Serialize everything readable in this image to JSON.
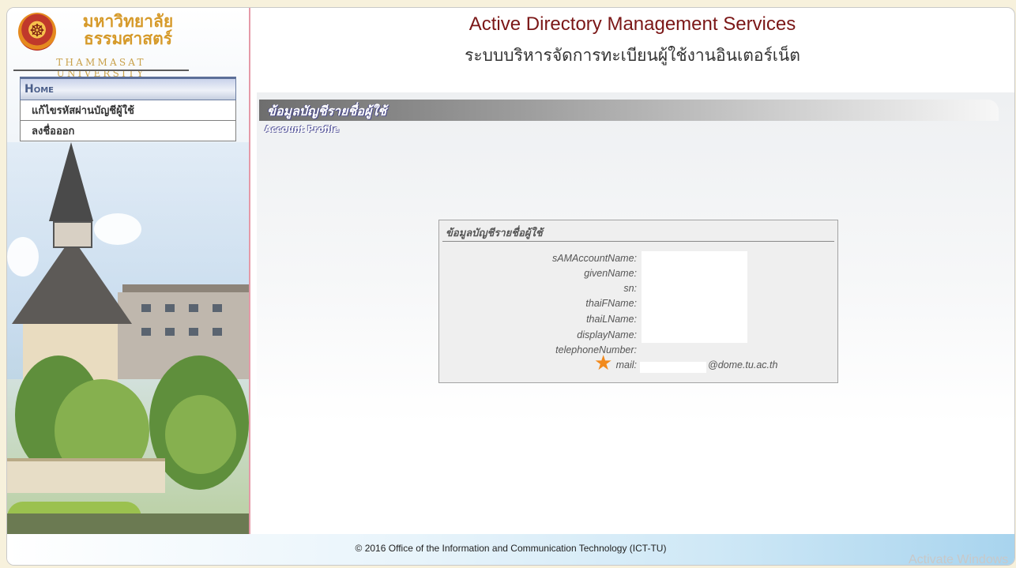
{
  "header": {
    "logo_thai_line1": "มหาวิทยาลัย",
    "logo_thai_line2": "ธรรมศาสตร์",
    "logo_en": "THAMMASAT UNIVERSITY",
    "title": "Active Directory Management Services",
    "subtitle": "ระบบบริหารจัดการทะเบียนผู้ใช้งานอินเตอร์เน็ต"
  },
  "menu": {
    "home": "Home",
    "items": [
      {
        "label": "แก้ไขรหัสผ่านบัญชีผู้ใช้"
      },
      {
        "label": "ลงชื่อออก"
      }
    ]
  },
  "section": {
    "title": "ข้อมูลบัญชีรายชื่อผู้ใช้",
    "subtitle": "Account Profile"
  },
  "profile": {
    "title": "ข้อมูลบัญชีรายชื่อผู้ใช้",
    "fields": [
      {
        "label": "sAMAccountName:",
        "value": ""
      },
      {
        "label": "givenName:",
        "value": ""
      },
      {
        "label": "sn:",
        "value": ""
      },
      {
        "label": "thaiFName:",
        "value": ""
      },
      {
        "label": "thaiLName:",
        "value": ""
      },
      {
        "label": "displayName:",
        "value": ""
      },
      {
        "label": "telephoneNumber:",
        "value": ""
      },
      {
        "label": "mail:",
        "value": ""
      }
    ],
    "mail_suffix": "@dome.tu.ac.th"
  },
  "footer": {
    "copyright": "© 2016 Office of the Information and Communication Technology (ICT-TU)"
  },
  "watermark": "Activate Windows",
  "colors": {
    "title": "#7b1717",
    "accent_star": "#f28a1d",
    "divider": "#e59aa8"
  }
}
